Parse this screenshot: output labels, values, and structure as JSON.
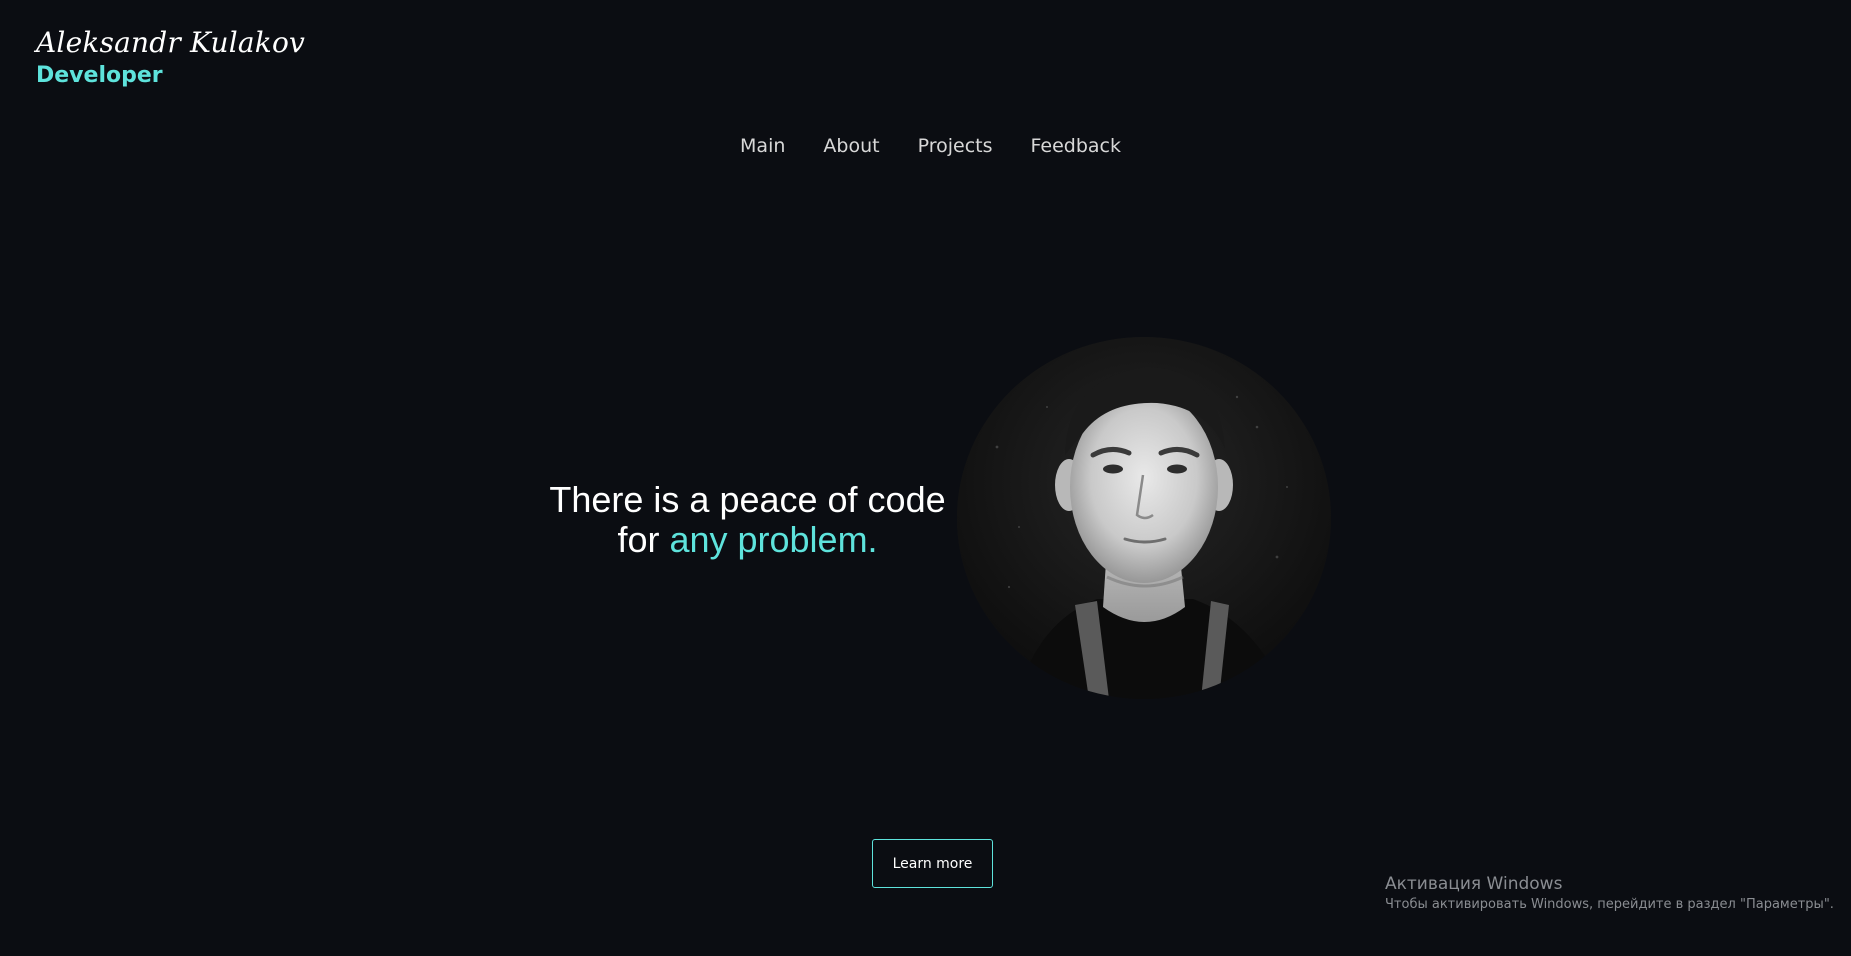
{
  "brand": {
    "name": "Aleksandr Kulakov",
    "role": "Developer"
  },
  "nav": {
    "items": [
      {
        "label": "Main"
      },
      {
        "label": "About"
      },
      {
        "label": "Projects"
      },
      {
        "label": "Feedback"
      }
    ]
  },
  "hero": {
    "line1": "There is a peace of code",
    "line2_prefix": "for ",
    "line2_accent": "any problem."
  },
  "cta": {
    "label": "Learn more"
  },
  "watermark": {
    "title": "Активация Windows",
    "subtitle": "Чтобы активировать Windows, перейдите в раздел \"Параметры\"."
  },
  "colors": {
    "background": "#0b0d12",
    "accent": "#5ee3dc",
    "text": "#ffffff"
  }
}
